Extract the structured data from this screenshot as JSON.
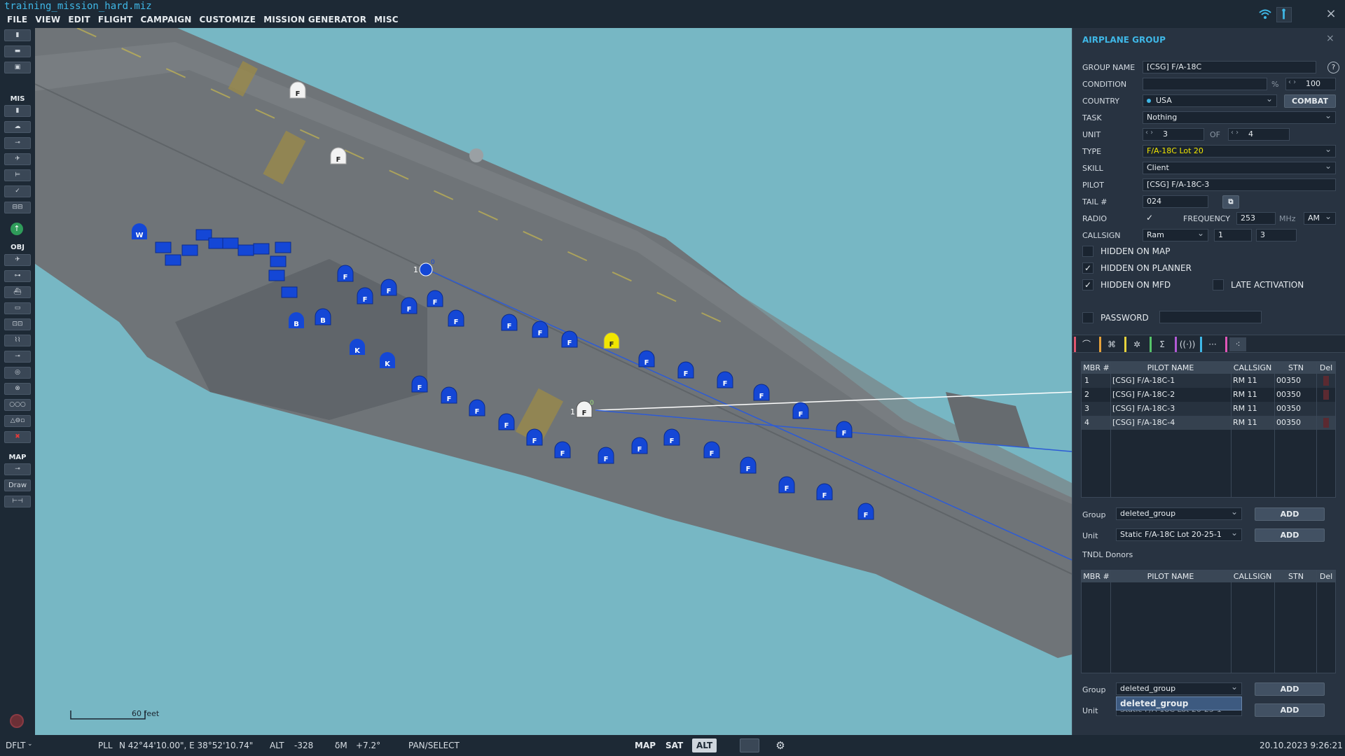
{
  "window": {
    "title": "training_mission_hard.miz"
  },
  "menu": [
    "FILE",
    "VIEW",
    "EDIT",
    "FLIGHT",
    "CAMPAIGN",
    "CUSTOMIZE",
    "MISSION GENERATOR",
    "MISC"
  ],
  "toolbar": {
    "section_mis": "MIS",
    "section_obj": "OBJ",
    "section_map": "MAP",
    "draw_label": "Draw"
  },
  "map": {
    "scale_label": "60 feet",
    "aircraft_markers": [
      {
        "letter": "F",
        "color": "white"
      },
      {
        "letter": "F",
        "color": "white"
      },
      {
        "letter": "W",
        "color": "blue"
      },
      {
        "letter": "B",
        "color": "blue"
      },
      {
        "letter": "B",
        "color": "blue"
      },
      {
        "letter": "K",
        "color": "blue"
      },
      {
        "letter": "K",
        "color": "blue"
      },
      {
        "letter": "F",
        "color": "yellow"
      },
      {
        "letter": "F",
        "color": "white"
      }
    ],
    "unit_index_labels": [
      "1",
      "0",
      "1",
      "0"
    ]
  },
  "statusbar": {
    "mode": "DFLT",
    "coord_label": "PLL",
    "coords": "N 42°44'10.00\", E 38°52'10.74\"",
    "alt_label": "ALT",
    "alt_value": "-328",
    "dm_label": "δM",
    "dm_value": "+7.2°",
    "tool": "PAN/SELECT",
    "view_map": "MAP",
    "view_sat": "SAT",
    "view_alt": "ALT",
    "datetime": "20.10.2023 9:26:21"
  },
  "panel": {
    "title": "AIRPLANE GROUP",
    "labels": {
      "group_name": "GROUP NAME",
      "condition": "CONDITION",
      "country": "COUNTRY",
      "task": "TASK",
      "unit": "UNIT",
      "of": "OF",
      "type": "TYPE",
      "skill": "SKILL",
      "pilot": "PILOT",
      "tail": "TAIL #",
      "radio": "RADIO",
      "frequency": "FREQUENCY",
      "mhz": "MHz",
      "callsign": "CALLSIGN",
      "percent": "%",
      "help": "?"
    },
    "values": {
      "group_name": "[CSG] F/A-18C",
      "condition": "",
      "condition_max": "100",
      "country": "USA",
      "combat_button": "COMBAT",
      "task": "Nothing",
      "unit": "3",
      "unit_of": "4",
      "type": "F/A-18C Lot 20",
      "skill": "Client",
      "pilot": "[CSG] F/A-18C-3",
      "tail": "024",
      "frequency": "253",
      "modulation": "AM",
      "callsign_name": "Ram",
      "callsign_1": "1",
      "callsign_2": "3",
      "radio_checked": "✓"
    },
    "checkboxes": {
      "hidden_on_map": {
        "label": "HIDDEN ON MAP",
        "mark": ""
      },
      "hidden_on_planner": {
        "label": "HIDDEN ON PLANNER",
        "mark": "✓"
      },
      "hidden_on_mfd": {
        "label": "HIDDEN ON MFD",
        "mark": "✓"
      },
      "late_activation": {
        "label": "LATE ACTIVATION",
        "mark": ""
      },
      "password": {
        "label": "PASSWORD",
        "mark": ""
      }
    },
    "members_table": {
      "columns": [
        "MBR #",
        "PILOT NAME",
        "CALLSIGN",
        "STN",
        "Del"
      ],
      "rows": [
        {
          "mbr": "1",
          "pilot": "[CSG] F/A-18C-1",
          "callsign": "RM 11",
          "stn": "00350"
        },
        {
          "mbr": "2",
          "pilot": "[CSG] F/A-18C-2",
          "callsign": "RM 11",
          "stn": "00350"
        },
        {
          "mbr": "3",
          "pilot": "[CSG] F/A-18C-3",
          "callsign": "RM 11",
          "stn": "00350"
        },
        {
          "mbr": "4",
          "pilot": "[CSG] F/A-18C-4",
          "callsign": "RM 11",
          "stn": "00350"
        }
      ]
    },
    "add_group_1": {
      "label": "Group",
      "value": "deleted_group",
      "button": "ADD"
    },
    "add_unit_1": {
      "label": "Unit",
      "value": "Static F/A-18C Lot 20-25-1",
      "button": "ADD"
    },
    "tndl_label": "TNDL Donors",
    "donors_table": {
      "columns": [
        "MBR #",
        "PILOT NAME",
        "CALLSIGN",
        "STN",
        "Del"
      ]
    },
    "add_group_2": {
      "label": "Group",
      "value": "deleted_group",
      "button": "ADD"
    },
    "add_unit_2": {
      "label": "Unit",
      "value": "Static F/A-18C Lot 20-25-1",
      "button": "ADD"
    },
    "dropdown_open_option": "deleted_group"
  },
  "colors": {
    "accent": "#3fb7e6",
    "sea": "#77b7c4",
    "deck": "#6e7479",
    "blue_unit": "#1447d6",
    "yellow_unit": "#f1e600"
  }
}
